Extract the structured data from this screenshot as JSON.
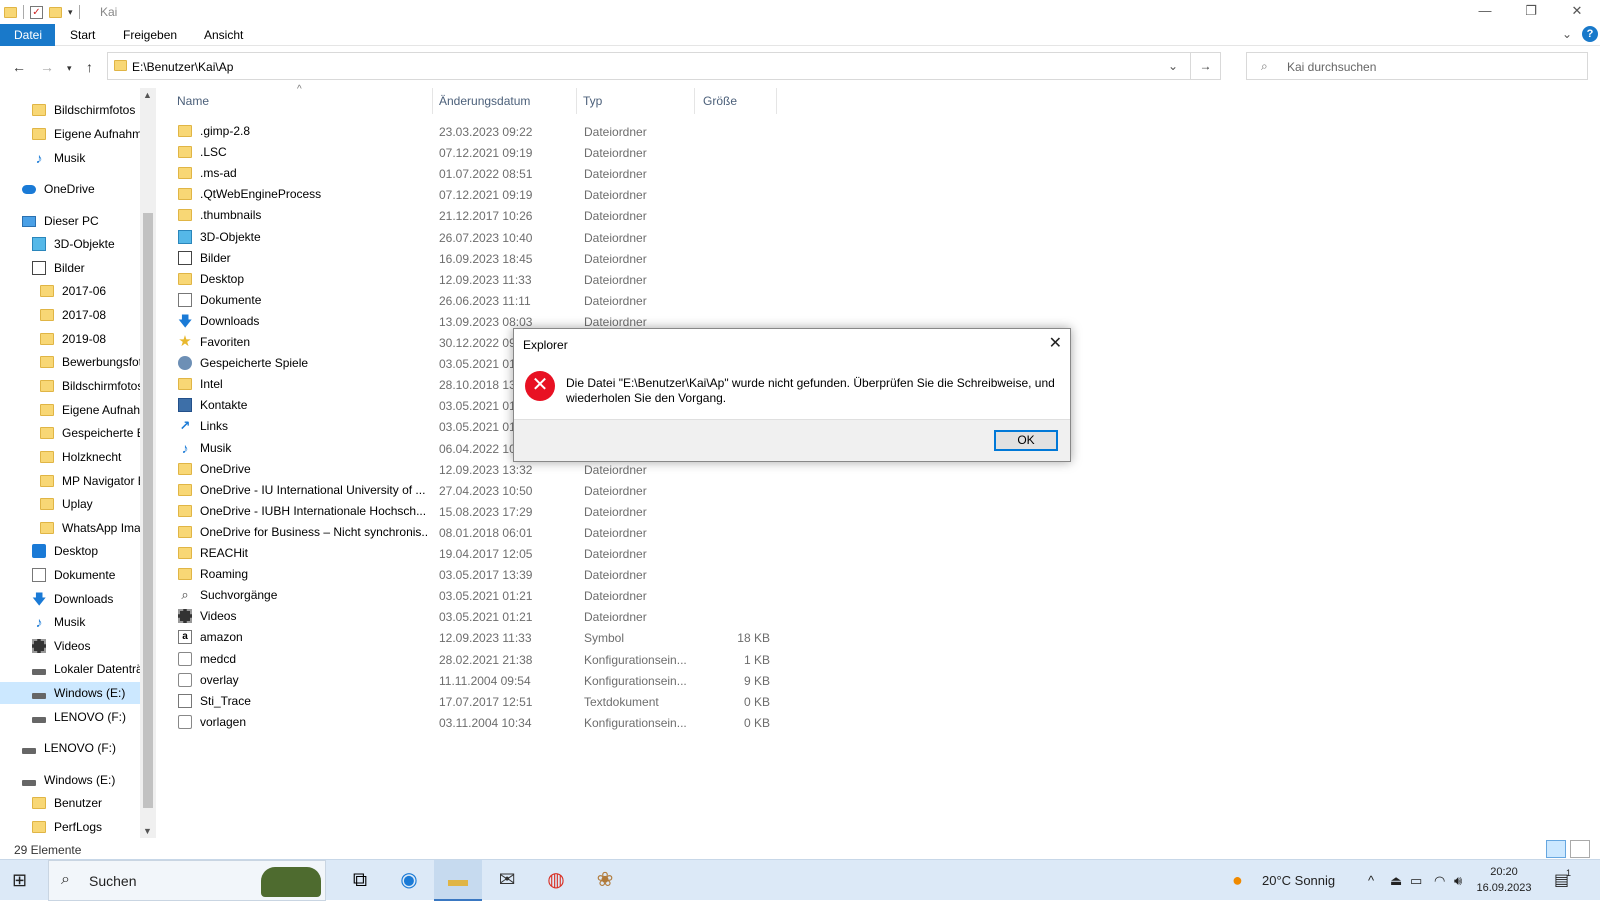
{
  "window": {
    "title": "Kai"
  },
  "ribbon": {
    "tabs": [
      "Datei",
      "Start",
      "Freigeben",
      "Ansicht"
    ]
  },
  "address": {
    "path": "E:\\Benutzer\\Kai\\Ap"
  },
  "search": {
    "placeholder": "Kai durchsuchen"
  },
  "nav": {
    "items": [
      {
        "label": "Bildschirmfotos",
        "icon": "folder-icon",
        "indent": 1
      },
      {
        "label": "Eigene Aufnahmen",
        "icon": "folder-icon",
        "indent": 1
      },
      {
        "label": "Musik",
        "icon": "music-icon",
        "indent": 1
      },
      {
        "label": "OneDrive",
        "icon": "onedrive-cloud-icon",
        "indent": 0
      },
      {
        "label": "Dieser PC",
        "icon": "computer-icon",
        "indent": 0
      },
      {
        "label": "3D-Objekte",
        "icon": "3d-objects-icon",
        "indent": 1
      },
      {
        "label": "Bilder",
        "icon": "pictures-icon",
        "indent": 1
      },
      {
        "label": "2017-06",
        "icon": "folder-icon",
        "indent": 2
      },
      {
        "label": "2017-08",
        "icon": "folder-icon",
        "indent": 2
      },
      {
        "label": "2019-08",
        "icon": "folder-icon",
        "indent": 2
      },
      {
        "label": "Bewerbungsfotos",
        "icon": "folder-icon",
        "indent": 2
      },
      {
        "label": "Bildschirmfotos",
        "icon": "folder-icon",
        "indent": 2
      },
      {
        "label": "Eigene Aufnahmen",
        "icon": "folder-icon",
        "indent": 2
      },
      {
        "label": "Gespeicherte Bilder",
        "icon": "folder-icon",
        "indent": 2
      },
      {
        "label": "Holzknecht",
        "icon": "folder-icon",
        "indent": 2
      },
      {
        "label": "MP Navigator EX",
        "icon": "folder-icon",
        "indent": 2
      },
      {
        "label": "Uplay",
        "icon": "folder-icon",
        "indent": 2
      },
      {
        "label": "WhatsApp Images",
        "icon": "folder-icon",
        "indent": 2
      },
      {
        "label": "Desktop",
        "icon": "desktop-icon",
        "indent": 1
      },
      {
        "label": "Dokumente",
        "icon": "documents-icon",
        "indent": 1
      },
      {
        "label": "Downloads",
        "icon": "downloads-icon",
        "indent": 1
      },
      {
        "label": "Musik",
        "icon": "music-icon",
        "indent": 1
      },
      {
        "label": "Videos",
        "icon": "videos-icon",
        "indent": 1
      },
      {
        "label": "Lokaler Datenträger (C:)",
        "icon": "local-disk-icon",
        "indent": 1
      },
      {
        "label": "Windows (E:)",
        "icon": "drive-icon",
        "indent": 1,
        "selected": true
      },
      {
        "label": "LENOVO (F:)",
        "icon": "drive-icon",
        "indent": 1
      },
      {
        "label": "LENOVO (F:)",
        "icon": "drive-icon",
        "indent": 0
      },
      {
        "label": "Windows (E:)",
        "icon": "drive-icon",
        "indent": 0
      },
      {
        "label": "Benutzer",
        "icon": "folder-icon",
        "indent": 1
      },
      {
        "label": "PerfLogs",
        "icon": "folder-icon",
        "indent": 1
      }
    ]
  },
  "columns": {
    "name": "Name",
    "date": "Änderungsdatum",
    "type": "Typ",
    "size": "Größe"
  },
  "files": [
    {
      "name": ".gimp-2.8",
      "date": "23.03.2023 09:22",
      "type": "Dateiordner",
      "size": "",
      "icon": "folder"
    },
    {
      "name": ".LSC",
      "date": "07.12.2021 09:19",
      "type": "Dateiordner",
      "size": "",
      "icon": "folder"
    },
    {
      "name": ".ms-ad",
      "date": "01.07.2022 08:51",
      "type": "Dateiordner",
      "size": "",
      "icon": "folder"
    },
    {
      "name": ".QtWebEngineProcess",
      "date": "07.12.2021 09:19",
      "type": "Dateiordner",
      "size": "",
      "icon": "folder"
    },
    {
      "name": ".thumbnails",
      "date": "21.12.2017 10:26",
      "type": "Dateiordner",
      "size": "",
      "icon": "folder"
    },
    {
      "name": "3D-Objekte",
      "date": "26.07.2023 10:40",
      "type": "Dateiordner",
      "size": "",
      "icon": "cube"
    },
    {
      "name": "Bilder",
      "date": "16.09.2023 18:45",
      "type": "Dateiordner",
      "size": "",
      "icon": "pic"
    },
    {
      "name": "Desktop",
      "date": "12.09.2023 11:33",
      "type": "Dateiordner",
      "size": "",
      "icon": "folder"
    },
    {
      "name": "Dokumente",
      "date": "26.06.2023 11:11",
      "type": "Dateiordner",
      "size": "",
      "icon": "doc"
    },
    {
      "name": "Downloads",
      "date": "13.09.2023 08:03",
      "type": "Dateiordner",
      "size": "",
      "icon": "arrowdn"
    },
    {
      "name": "Favoriten",
      "date": "30.12.2022 09:4",
      "type": "",
      "size": "",
      "icon": "star"
    },
    {
      "name": "Gespeicherte Spiele",
      "date": "03.05.2021 01:2",
      "type": "",
      "size": "",
      "icon": "game"
    },
    {
      "name": "Intel",
      "date": "28.10.2018 13:2",
      "type": "",
      "size": "",
      "icon": "folder"
    },
    {
      "name": "Kontakte",
      "date": "03.05.2021 01:2",
      "type": "",
      "size": "",
      "icon": "contact"
    },
    {
      "name": "Links",
      "date": "03.05.2021 01:2",
      "type": "",
      "size": "",
      "icon": "link"
    },
    {
      "name": "Musik",
      "date": "06.04.2022 10:0",
      "type": "",
      "size": "",
      "icon": "note"
    },
    {
      "name": "OneDrive",
      "date": "12.09.2023 13:32",
      "type": "Dateiordner",
      "size": "",
      "icon": "folder"
    },
    {
      "name": "OneDrive - IU International University of ...",
      "date": "27.04.2023 10:50",
      "type": "Dateiordner",
      "size": "",
      "icon": "folder"
    },
    {
      "name": "OneDrive - IUBH Internationale Hochsch...",
      "date": "15.08.2023 17:29",
      "type": "Dateiordner",
      "size": "",
      "icon": "folder"
    },
    {
      "name": "OneDrive for Business – Nicht synchronis...",
      "date": "08.01.2018 06:01",
      "type": "Dateiordner",
      "size": "",
      "icon": "folder"
    },
    {
      "name": "REACHit",
      "date": "19.04.2017 12:05",
      "type": "Dateiordner",
      "size": "",
      "icon": "folder"
    },
    {
      "name": "Roaming",
      "date": "03.05.2017 13:39",
      "type": "Dateiordner",
      "size": "",
      "icon": "folder"
    },
    {
      "name": "Suchvorgänge",
      "date": "03.05.2021 01:21",
      "type": "Dateiordner",
      "size": "",
      "icon": "srch"
    },
    {
      "name": "Videos",
      "date": "03.05.2021 01:21",
      "type": "Dateiordner",
      "size": "",
      "icon": "film"
    },
    {
      "name": "amazon",
      "date": "12.09.2023 11:33",
      "type": "Symbol",
      "size": "18 KB",
      "icon": "amz"
    },
    {
      "name": "medcd",
      "date": "28.02.2021 21:38",
      "type": "Konfigurationsein...",
      "size": "1 KB",
      "icon": "cfg"
    },
    {
      "name": "overlay",
      "date": "11.11.2004 09:54",
      "type": "Konfigurationsein...",
      "size": "9 KB",
      "icon": "cfg"
    },
    {
      "name": "Sti_Trace",
      "date": "17.07.2017 12:51",
      "type": "Textdokument",
      "size": "0 KB",
      "icon": "txt"
    },
    {
      "name": "vorlagen",
      "date": "03.11.2004 10:34",
      "type": "Konfigurationsein...",
      "size": "0 KB",
      "icon": "cfg"
    }
  ],
  "status": {
    "count": "29 Elemente"
  },
  "dialog": {
    "title": "Explorer",
    "message": "Die Datei \"E:\\Benutzer\\Kai\\Ap\" wurde nicht gefunden. Überprüfen Sie die Schreibweise, und wiederholen Sie den Vorgang.",
    "ok": "OK"
  },
  "taskbar": {
    "search": "Suchen",
    "weather": "20°C  Sonnig",
    "time": "20:20",
    "date": "16.09.2023",
    "notifications": "1"
  },
  "colors": {
    "accent": "#1979ca",
    "error": "#e81123",
    "taskbar": "#dce9f7",
    "selected": "#cce8ff"
  }
}
